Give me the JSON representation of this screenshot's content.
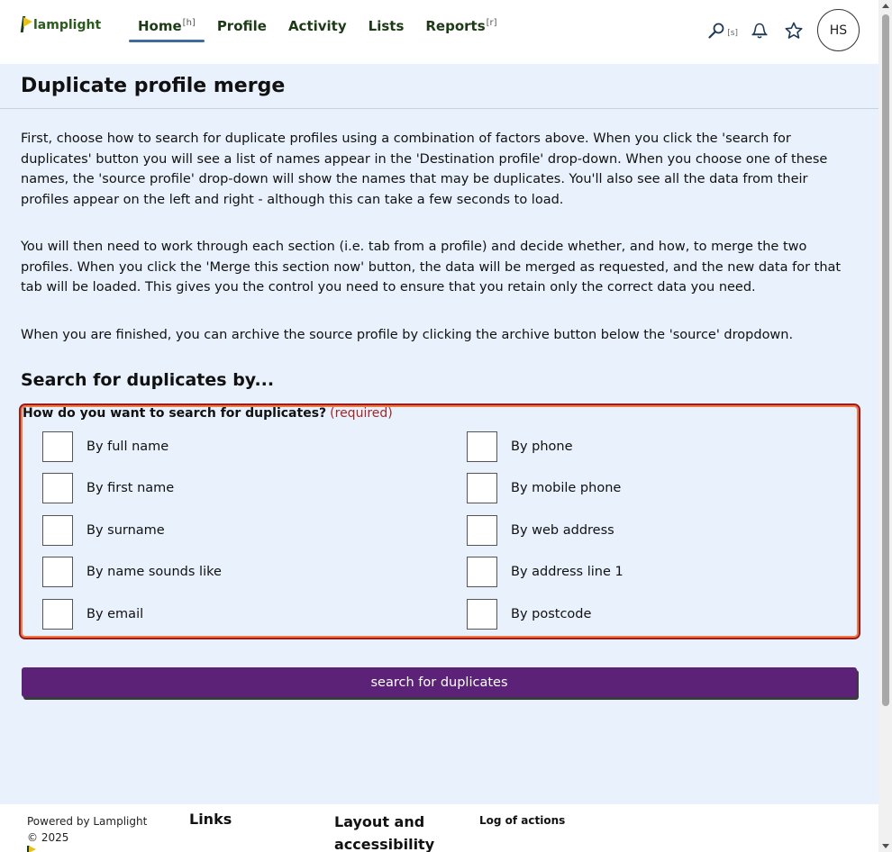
{
  "header": {
    "logo_text": "lamplight",
    "nav": [
      {
        "label": "Home",
        "shortcut": "[h]"
      },
      {
        "label": "Profile",
        "shortcut": ""
      },
      {
        "label": "Activity",
        "shortcut": ""
      },
      {
        "label": "Lists",
        "shortcut": ""
      },
      {
        "label": "Reports",
        "shortcut": "[r]"
      }
    ],
    "search_shortcut": "[s]",
    "avatar_initials": "HS"
  },
  "page": {
    "title": "Duplicate profile merge",
    "intro": [
      "First, choose how to search for duplicate profiles using a combination of factors above. When you click the 'search for duplicates' button you will see a list of names appear in the 'Destination profile' drop-down. When you choose one of these names, the 'source profile' drop-down will show the names that may be duplicates. You'll also see all the data from their profiles appear on the left and right - although this can take a few seconds to load.",
      "You will then need to work through each section (i.e. tab from a profile) and decide whether, and how, to merge the two profiles. When you click the 'Merge this section now' button, the data will be merged as requested, and the new data for that tab will be loaded. This gives you the control you need to ensure that you retain only the correct data you need.",
      "When you are finished, you can archive the source profile by clicking the archive button below the 'source' dropdown."
    ],
    "section_title": "Search for duplicates by...",
    "question": "How do you want to search for duplicates?",
    "required_label": "(required)",
    "options_left": [
      "By full name",
      "By first name",
      "By surname",
      "By name sounds like",
      "By email"
    ],
    "options_right": [
      "By phone",
      "By mobile phone",
      "By web address",
      "By address line 1",
      "By postcode"
    ],
    "search_button": "search for duplicates"
  },
  "footer": {
    "powered_by": "Powered by Lamplight",
    "copyright": "© 2025",
    "links_heading": "Links",
    "layout_heading": "Layout and accessibility",
    "log_heading": "Log of actions"
  },
  "colors": {
    "accent_purple": "#5c2278",
    "nav_underline": "#3f6c9c",
    "required_red": "#a42727",
    "background": "#e8f1fc"
  }
}
